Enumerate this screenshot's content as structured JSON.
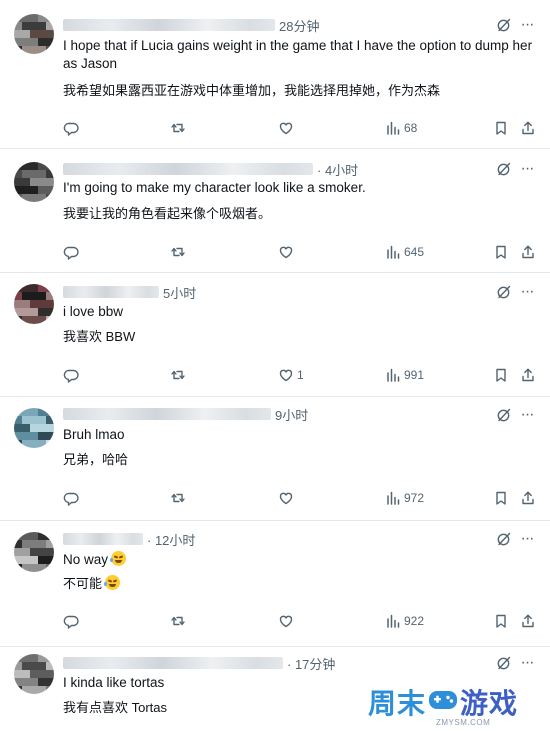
{
  "tweets": [
    {
      "time": "28分钟",
      "text": "I hope that if Lucia gains weight in the game that I have the option to dump her as Jason",
      "translation": "我希望如果露西亚在游戏中体重增加，我能选择甩掉她，作为杰森",
      "likes": "",
      "views": "68"
    },
    {
      "time": "· 4小时",
      "text": "I'm going to make my character look like a smoker.",
      "translation": "我要让我的角色看起来像个吸烟者。",
      "likes": "",
      "views": "645"
    },
    {
      "time": "5小时",
      "text": "i love bbw",
      "translation": "我喜欢 BBW",
      "likes": "1",
      "views": "991"
    },
    {
      "time": "9小时",
      "text": "Bruh lmao",
      "translation": "兄弟，哈哈",
      "likes": "",
      "views": "972"
    },
    {
      "time": "· 12小时",
      "text": "No way",
      "translation": "不可能",
      "likes": "",
      "views": "922"
    },
    {
      "time": "· 17分钟",
      "text": "I kinda like tortas",
      "translation": "我有点喜欢 Tortas",
      "likes": "",
      "views": ""
    }
  ],
  "icons": {
    "reply": "reply-icon",
    "retweet": "retweet-icon",
    "like": "heart-icon",
    "views": "views-icon",
    "bookmark": "bookmark-icon",
    "share": "share-icon",
    "grok": "grok-icon",
    "more": "more-icon",
    "emoji": "rofl-emoji-icon"
  },
  "colors": {
    "text": "#0f1419",
    "secondary": "#536471",
    "divider": "#e6e9ec",
    "watermark_blue": "#2d8fd8",
    "watermark_indigo": "#3e5fc4"
  },
  "watermark": {
    "brand_left": "周末",
    "brand_right": "游戏",
    "url": "ZMYSM.COM"
  }
}
